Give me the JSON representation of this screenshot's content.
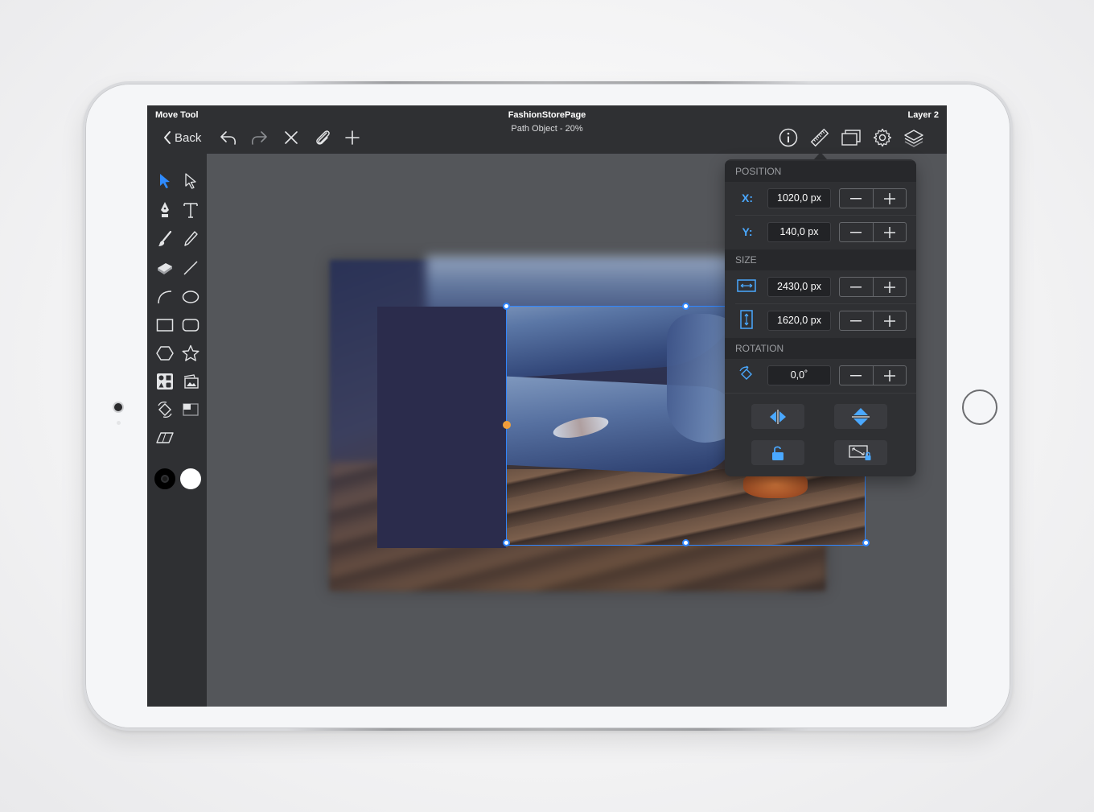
{
  "topbar": {
    "tool_name": "Move Tool",
    "document_title": "FashionStorePage",
    "document_subtitle": "Path Object - 20%",
    "layer_name": "Layer 2",
    "back_label": "Back"
  },
  "inspector": {
    "position_header": "POSITION",
    "size_header": "SIZE",
    "rotation_header": "ROTATION",
    "x_label": "X:",
    "x_value": "1020,0 px",
    "y_label": "Y:",
    "y_value": "140,0 px",
    "width_value": "2430,0 px",
    "height_value": "1620,0 px",
    "rotation_value": "0,0˚"
  },
  "colors": {
    "accent": "#4aa8ff",
    "selection": "#2f86ff",
    "origin_handle": "#f39a3a",
    "toolbar_bg": "#2f3033",
    "canvas_bg": "#54565a"
  },
  "toolbar_icons": [
    "undo-icon",
    "redo-icon",
    "close-icon",
    "paperclip-icon",
    "plus-icon",
    "info-icon",
    "ruler-icon",
    "artboard-icon",
    "gear-icon",
    "layers-icon"
  ],
  "tools": [
    "move-arrow",
    "direct-select-arrow",
    "pen",
    "text",
    "brush",
    "pencil",
    "eraser",
    "line",
    "arc",
    "ellipse",
    "rectangle",
    "rounded-rectangle",
    "hexagon",
    "star",
    "symbol",
    "image",
    "transform",
    "arrange",
    "skew"
  ]
}
